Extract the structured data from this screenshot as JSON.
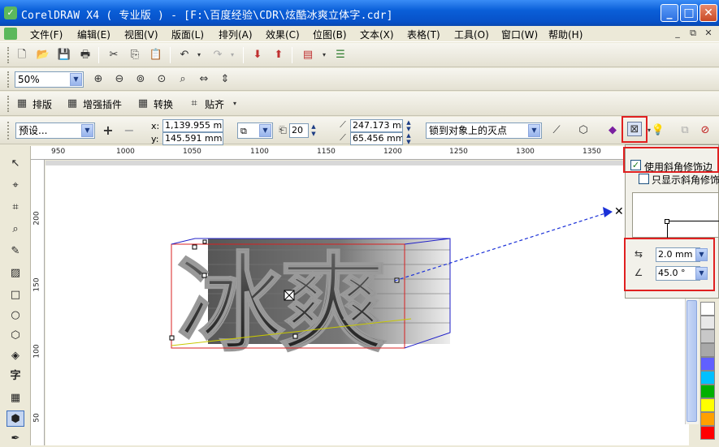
{
  "window": {
    "title": "CorelDRAW X4 ( 专业版 ) - [F:\\百度经验\\CDR\\炫酷冰爽立体字.cdr]",
    "app_icon": "coreldraw-logo",
    "buttons": {
      "minimize": "_",
      "maximize": "□",
      "close": "✕"
    }
  },
  "menu": {
    "items": [
      "文件(F)",
      "编辑(E)",
      "视图(V)",
      "版面(L)",
      "排列(A)",
      "效果(C)",
      "位图(B)",
      "文本(X)",
      "表格(T)",
      "工具(O)",
      "窗口(W)",
      "帮助(H)"
    ],
    "mdi": {
      "minimize": "_",
      "restore": "⧉",
      "close": "✕"
    }
  },
  "standard_toolbar": {
    "icons": [
      "new-icon",
      "open-icon",
      "save-icon",
      "print-icon",
      "cut-icon",
      "copy-icon",
      "paste-icon",
      "undo-icon",
      "redo-icon",
      "import-icon",
      "export-icon",
      "application-launcher-icon",
      "options-icon"
    ]
  },
  "zoom_toolbar": {
    "zoom_level": "50%",
    "icons": [
      "zoom-in-icon",
      "zoom-out-icon",
      "zoom-selected-icon",
      "zoom-all-icon",
      "zoom-page-icon",
      "zoom-width-icon",
      "zoom-height-icon"
    ]
  },
  "text_toolbar": {
    "items": [
      "排版",
      "增强插件",
      "转换",
      "贴齐"
    ]
  },
  "property_bar": {
    "preset": "预设...",
    "x_label": "x:",
    "x_value": "1,139.955 mm",
    "y_label": "y:",
    "y_value": "145.591 mm",
    "depth": "20",
    "vp_x": "247.173 mm",
    "vp_y": "65.456 mm",
    "vanishing_point": "锁到对象上的灭点"
  },
  "ruler": {
    "h_labels": [
      "950",
      "1000",
      "1050",
      "1100",
      "1150",
      "1200",
      "1250",
      "1300",
      "1350"
    ],
    "v_labels": [
      "200",
      "150",
      "100",
      "50"
    ],
    "corner": "⊹"
  },
  "canvas": {
    "artwork_text": "冰爽"
  },
  "bevel_popup": {
    "use_bevel_label": "使用斜角修饰边",
    "use_bevel_checked": true,
    "bevel_only_label": "只显示斜角修饰",
    "bevel_only_checked": false,
    "depth_value": "2.0 mm",
    "angle_value": "45.0 °"
  },
  "palette": {
    "colors": [
      "#ffffff",
      "#e8e8e8",
      "#c8c8c8",
      "#a8a8a8",
      "#6060ff",
      "#00c0ff",
      "#00b000",
      "#ffff00",
      "#ffa000",
      "#ff0000",
      "#e040a0"
    ]
  },
  "highlights": {
    "color": "#e02020"
  }
}
